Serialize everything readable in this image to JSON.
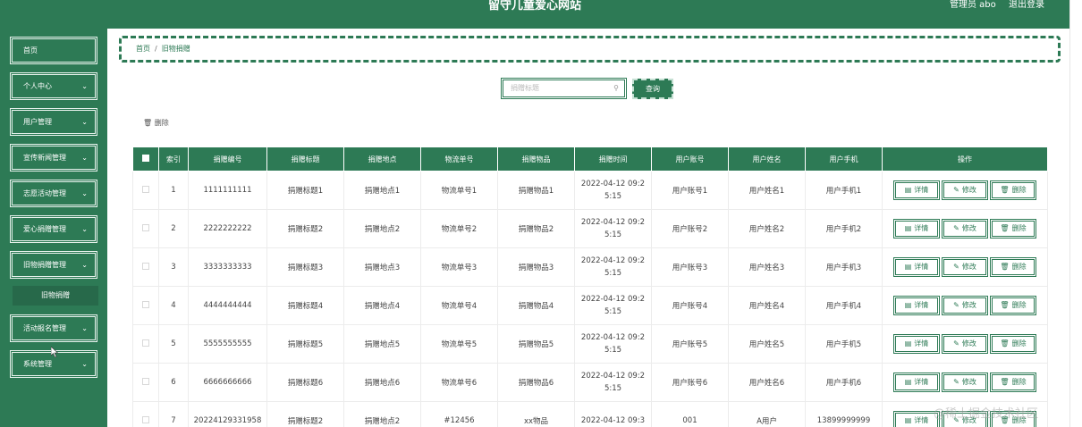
{
  "header": {
    "title": "留守儿童爱心网站",
    "user_label": "管理员 abo",
    "logout_label": "退出登录"
  },
  "sidebar": {
    "items": [
      {
        "label": "首页",
        "chevron": false
      },
      {
        "label": "个人中心",
        "chevron": true
      },
      {
        "label": "用户管理",
        "chevron": true
      },
      {
        "label": "宣传新闻管理",
        "chevron": true
      },
      {
        "label": "志愿活动管理",
        "chevron": true
      },
      {
        "label": "爱心捐赠管理",
        "chevron": true
      },
      {
        "label": "旧物捐赠管理",
        "chevron": true
      },
      {
        "label": "活动报名管理",
        "chevron": true
      },
      {
        "label": "系统管理",
        "chevron": true
      }
    ],
    "sub_item": "旧物捐赠"
  },
  "breadcrumb": {
    "home": "首页",
    "sep": "/",
    "current": "旧物捐赠"
  },
  "search": {
    "placeholder": "捐赠标题",
    "button_label": "查询"
  },
  "toolbar": {
    "delete_label": "删除",
    "delete_icon": "trash-icon"
  },
  "table": {
    "columns": [
      "索引",
      "捐赠编号",
      "捐赠标题",
      "捐赠地点",
      "物流单号",
      "捐赠物品",
      "捐赠时间",
      "用户账号",
      "用户姓名",
      "用户手机",
      "操作"
    ],
    "actions": {
      "detail": "详情",
      "edit": "修改",
      "delete": "删除"
    },
    "rows": [
      {
        "index": "1",
        "no": "1111111111",
        "title": "捐赠标题1",
        "place": "捐赠地点1",
        "logistics": "物流单号1",
        "item": "捐赠物品1",
        "time1": "2022-04-12 09:2",
        "time2": "5:15",
        "account": "用户账号1",
        "name": "用户姓名1",
        "phone": "用户手机1"
      },
      {
        "index": "2",
        "no": "2222222222",
        "title": "捐赠标题2",
        "place": "捐赠地点2",
        "logistics": "物流单号2",
        "item": "捐赠物品2",
        "time1": "2022-04-12 09:2",
        "time2": "5:15",
        "account": "用户账号2",
        "name": "用户姓名2",
        "phone": "用户手机2"
      },
      {
        "index": "3",
        "no": "3333333333",
        "title": "捐赠标题3",
        "place": "捐赠地点3",
        "logistics": "物流单号3",
        "item": "捐赠物品3",
        "time1": "2022-04-12 09:2",
        "time2": "5:15",
        "account": "用户账号3",
        "name": "用户姓名3",
        "phone": "用户手机3"
      },
      {
        "index": "4",
        "no": "4444444444",
        "title": "捐赠标题4",
        "place": "捐赠地点4",
        "logistics": "物流单号4",
        "item": "捐赠物品4",
        "time1": "2022-04-12 09:2",
        "time2": "5:15",
        "account": "用户账号4",
        "name": "用户姓名4",
        "phone": "用户手机4"
      },
      {
        "index": "5",
        "no": "5555555555",
        "title": "捐赠标题5",
        "place": "捐赠地点5",
        "logistics": "物流单号5",
        "item": "捐赠物品5",
        "time1": "2022-04-12 09:2",
        "time2": "5:15",
        "account": "用户账号5",
        "name": "用户姓名5",
        "phone": "用户手机5"
      },
      {
        "index": "6",
        "no": "6666666666",
        "title": "捐赠标题6",
        "place": "捐赠地点6",
        "logistics": "物流单号6",
        "item": "捐赠物品6",
        "time1": "2022-04-12 09:2",
        "time2": "5:15",
        "account": "用户账号6",
        "name": "用户姓名6",
        "phone": "用户手机6"
      },
      {
        "index": "7",
        "no": "20224129331958",
        "title": "捐赠标题2",
        "place": "捐赠地点2",
        "logistics": "#12456",
        "item": "xx物品",
        "time1": "2022-04-12 09:3",
        "time2": "",
        "account": "001",
        "name": "A用户",
        "phone": "13899999999"
      }
    ]
  },
  "watermark": "@稀土掘金技术社区",
  "colors": {
    "primary": "#2d7a55",
    "sub_item_bg": "#27694a"
  }
}
